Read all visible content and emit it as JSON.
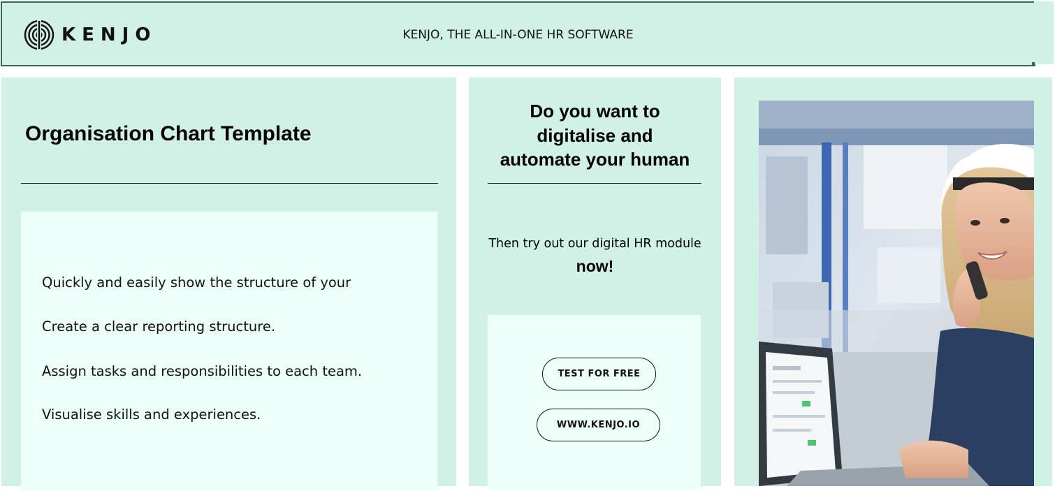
{
  "header": {
    "brand": "KENJO",
    "tagline": "KENJO, THE ALL-IN-ONE HR SOFTWARE"
  },
  "left_panel": {
    "title": "Organisation Chart Template",
    "bullets": [
      "Quickly and easily show the structure of your",
      "Create a clear reporting structure.",
      "Assign tasks and responsibilities to each team.",
      "Visualise skills and experiences."
    ]
  },
  "middle_panel": {
    "title_lines": [
      "Do you want to",
      "digitalise and",
      "automate your human"
    ],
    "subtitle": "Then try out our digital HR module",
    "emphasis": "now!",
    "buttons": {
      "test": "TEST FOR FREE",
      "website": "WWW.KENJO.IO"
    }
  },
  "colors": {
    "panel_bg": "#d1f0e6",
    "card_bg": "#edfff9",
    "header_border": "#2f6b4c"
  },
  "icons": [
    "kenjo-logo-icon"
  ]
}
